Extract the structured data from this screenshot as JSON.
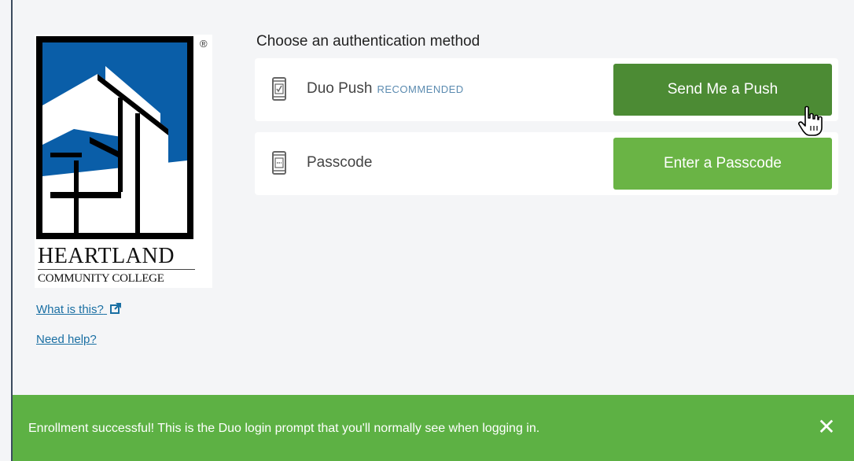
{
  "logo": {
    "registered_mark": "®",
    "name": "HEARTLAND",
    "subtitle": "COMMUNITY COLLEGE"
  },
  "sidebar": {
    "what_is_this": "What is this?",
    "need_help": "Need help?"
  },
  "main": {
    "heading": "Choose an authentication method",
    "methods": [
      {
        "label": "Duo Push",
        "badge": "RECOMMENDED",
        "icon": "phone-check-icon",
        "button": "Send Me a Push"
      },
      {
        "label": "Passcode",
        "icon": "phone-passcode-icon",
        "button": "Enter a Passcode"
      }
    ]
  },
  "banner": {
    "message": "Enrollment successful! This is the Duo login prompt that you'll normally see when logging in.",
    "close": "✕"
  },
  "colors": {
    "button_dark": "#4c8b34",
    "button_light": "#6ab445",
    "banner": "#5db144",
    "link": "#1a6fa3"
  }
}
